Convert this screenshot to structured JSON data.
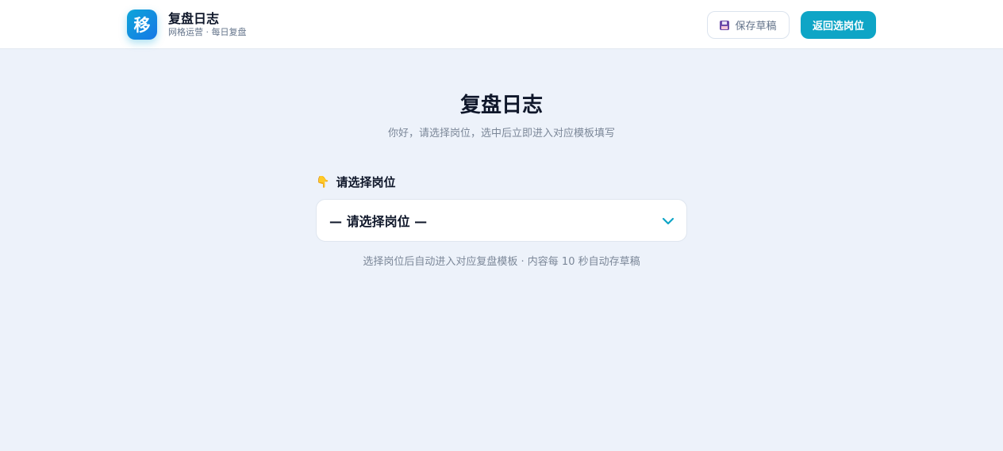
{
  "header": {
    "logo_char": "移",
    "app_name": "复盘日志",
    "app_subtitle": "网格运营 · 每日复盘",
    "save_label": "保存草稿",
    "back_label": "返回选岗位"
  },
  "main": {
    "title": "复盘日志",
    "subtitle": "你好，请选择岗位，选中后立即进入对应模板填写",
    "field_icon": "👇",
    "field_label": "请选择岗位",
    "select_value": "— 请选择岗位 —",
    "hint": "选择岗位后自动进入对应复盘模板 · 内容每 10 秒自动存草稿"
  },
  "icons": {
    "save": "floppy-disk-icon",
    "select": "chevron-down-icon",
    "label": "pointing-down-hand-icon"
  },
  "colors": {
    "accent": "#0ea5c6",
    "page_bg": "#edf2fa"
  }
}
